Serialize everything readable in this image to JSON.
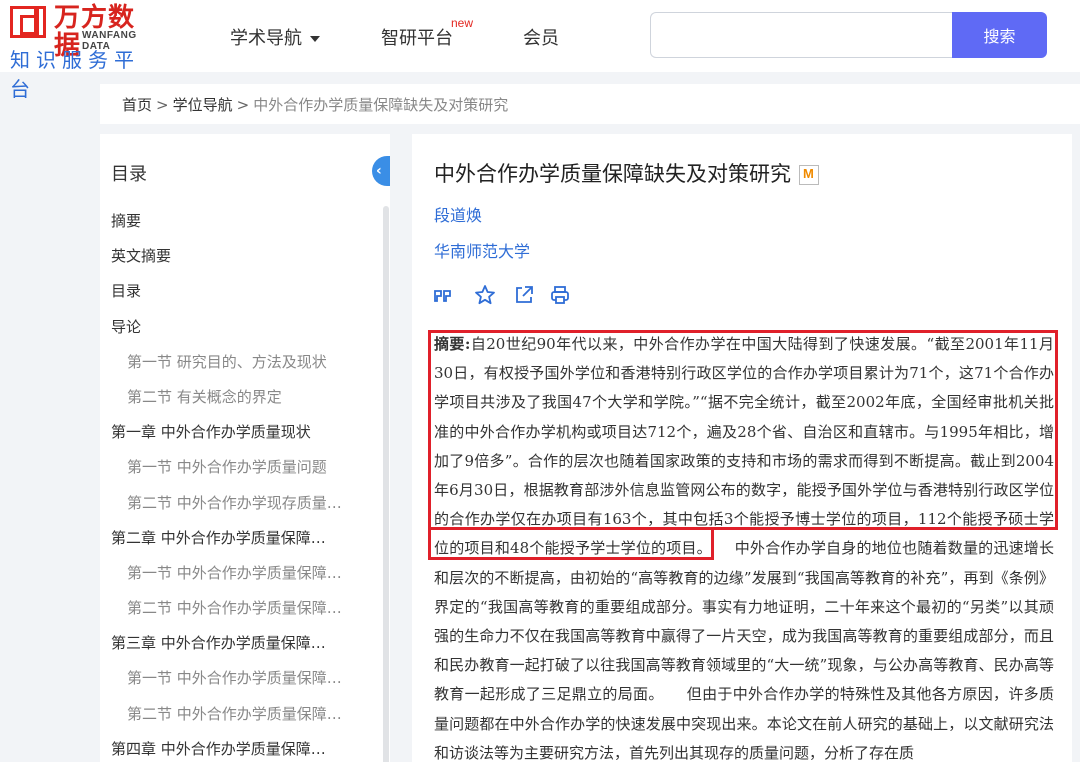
{
  "header": {
    "logo_cn": "万方数据",
    "logo_en": "WANFANG DATA",
    "logo_sub": "知识服务平台",
    "nav": [
      {
        "label": "学术导航",
        "dropdown": true
      },
      {
        "label": "智研平台",
        "badge": "new"
      },
      {
        "label": "会员"
      }
    ],
    "search": {
      "placeholder": "",
      "value": "",
      "button": "搜索"
    }
  },
  "breadcrumb": {
    "items": [
      "首页",
      "学位导航"
    ],
    "separator": ">",
    "current": "中外合作办学质量保障缺失及对策研究"
  },
  "toc": {
    "title": "目录",
    "items": [
      {
        "label": "摘要",
        "level": 1
      },
      {
        "label": "英文摘要",
        "level": 1
      },
      {
        "label": "目录",
        "level": 1
      },
      {
        "label": "导论",
        "level": 1
      },
      {
        "label": "第一节 研究目的、方法及现状",
        "level": 2
      },
      {
        "label": "第二节 有关概念的界定",
        "level": 2
      },
      {
        "label": "第一章 中外合作办学质量现状",
        "level": 1
      },
      {
        "label": "第一节 中外合作办学质量问题",
        "level": 2
      },
      {
        "label": "第二节 中外合作办学现存质量…",
        "level": 2
      },
      {
        "label": "第二章 中外合作办学质量保障…",
        "level": 1
      },
      {
        "label": "第一节 中外合作办学质量保障…",
        "level": 2
      },
      {
        "label": "第二节 中外合作办学质量保障…",
        "level": 2
      },
      {
        "label": "第三章 中外合作办学质量保障…",
        "level": 1
      },
      {
        "label": "第一节 中外合作办学质量保障…",
        "level": 2
      },
      {
        "label": "第二节 中外合作办学质量保障…",
        "level": 2
      },
      {
        "label": "第四章 中外合作办学质量保障…",
        "level": 1
      }
    ]
  },
  "paper": {
    "title": "中外合作办学质量保障缺失及对策研究",
    "author": "段道焕",
    "institution": "华南师范大学",
    "abstract_label": "摘要:",
    "abstract_text": "自20世纪90年代以来，中外合作办学在中国大陆得到了快速发展。“截至2001年11月30日，有权授予国外学位和香港特别行政区学位的合作办学项目累计为71个，这71个合作办学项目共涉及了我国47个大学和学院。”“据不完全统计，截至2002年底，全国经审批机关批准的中外合作办学机构或项目达712个，遍及28个省、自治区和直辖市。与1995年相比，增加了9倍多”。合作的层次也随着国家政策的支持和市场的需求而得到不断提高。截止到2004年6月30日，根据教育部涉外信息监管网公布的数字，能授予国外学位与香港特别行政区学位的合作办学仅在办项目有163个，其中包括3个能授予博士学位的项目，112个能授予硕士学位的项目和48个能授予学士学位的项目。　　中外合作办学自身的地位也随着数量的迅速增长和层次的不断提高，由初始的“高等教育的边缘”发展到“我国高等教育的补充”，再到《条例》界定的“我国高等教育的重要组成部分。事实有力地证明，二十年来这个最初的“另类”以其顽强的生命力不仅在我国高等教育中赢得了一片天空，成为我国高等教育的重要组成部分，而且和民办教育一起打破了以往我国高等教育领域里的“大一统”现象，与公办高等教育、民办高等教育一起形成了三足鼎立的局面。　　但由于中外合作办学的特殊性及其他各方原因，许多质量问题都在中外合作办学的快速发展中突现出来。本论文在前人研究的基础上，以文献研究法和访谈法等为主要研究方法，首先列出其现存的质量问题，分析了存在质"
  },
  "colors": {
    "accent": "#5f6af5",
    "link": "#2f6dd6",
    "brand_red": "#e32620",
    "highlight_border": "#e0202a"
  },
  "icons": [
    "cite-icon",
    "star-icon",
    "share-icon",
    "print-icon",
    "chevron-left-icon"
  ]
}
